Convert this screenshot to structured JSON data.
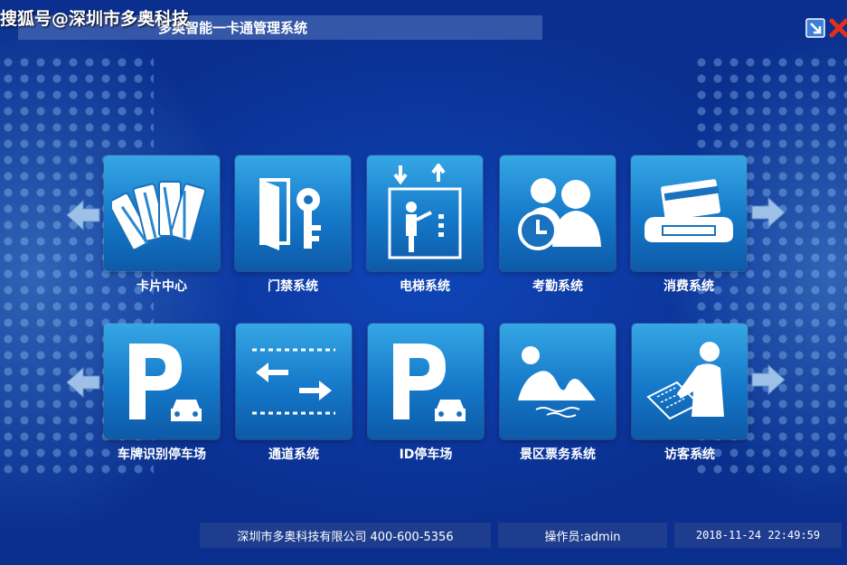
{
  "watermark": "搜狐号@深圳市多奥科技",
  "app": {
    "title": "多奥智能一卡通管理系统"
  },
  "modules": [
    {
      "label": "卡片中心",
      "icon": "cards-icon"
    },
    {
      "label": "门禁系统",
      "icon": "door-key-icon"
    },
    {
      "label": "电梯系统",
      "icon": "elevator-icon"
    },
    {
      "label": "考勤系统",
      "icon": "attendance-icon"
    },
    {
      "label": "消费系统",
      "icon": "pos-card-reader-icon"
    },
    {
      "label": "车牌识别停车场",
      "icon": "parking-car-icon"
    },
    {
      "label": "通道系统",
      "icon": "channel-arrows-icon"
    },
    {
      "label": "ID停车场",
      "icon": "parking-car-icon"
    },
    {
      "label": "景区票务系统",
      "icon": "scenic-mountain-icon"
    },
    {
      "label": "访客系统",
      "icon": "visitor-sign-icon"
    }
  ],
  "status": {
    "company": "深圳市多奥科技有限公司 400-600-5356",
    "operator": "操作员:admin",
    "datetime": "2018-11-24 22:49:59"
  },
  "colors": {
    "tile_top": "#35a7e5",
    "tile_bottom": "#0d5aa8",
    "background": "#0a2f8f"
  }
}
